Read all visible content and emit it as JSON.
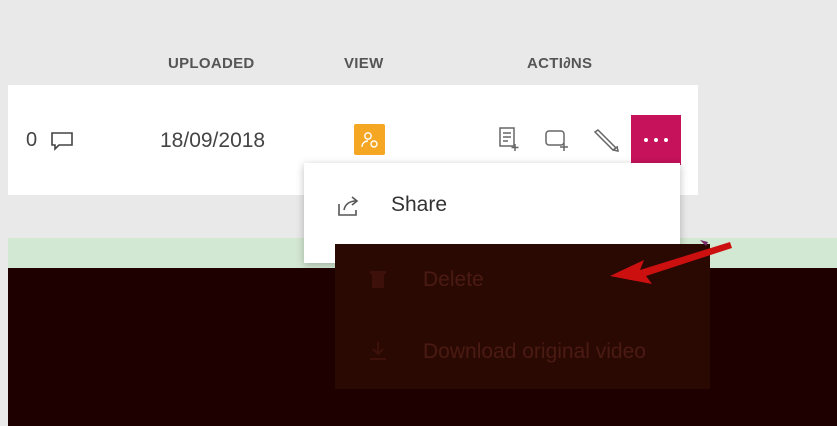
{
  "columns": {
    "uploaded": "UPLOADED",
    "view": "VIEW",
    "actions": "ACTI∂NS"
  },
  "row": {
    "comment_count": "0",
    "uploaded_date": "18/09/2018"
  },
  "menu": {
    "share_label": "Share",
    "delete_label": "Delete",
    "download_label": "Download original video"
  },
  "colors": {
    "accent_more": "#c5125b",
    "view_badge": "#f5a623",
    "annotation_arrow": "#cc1010"
  }
}
